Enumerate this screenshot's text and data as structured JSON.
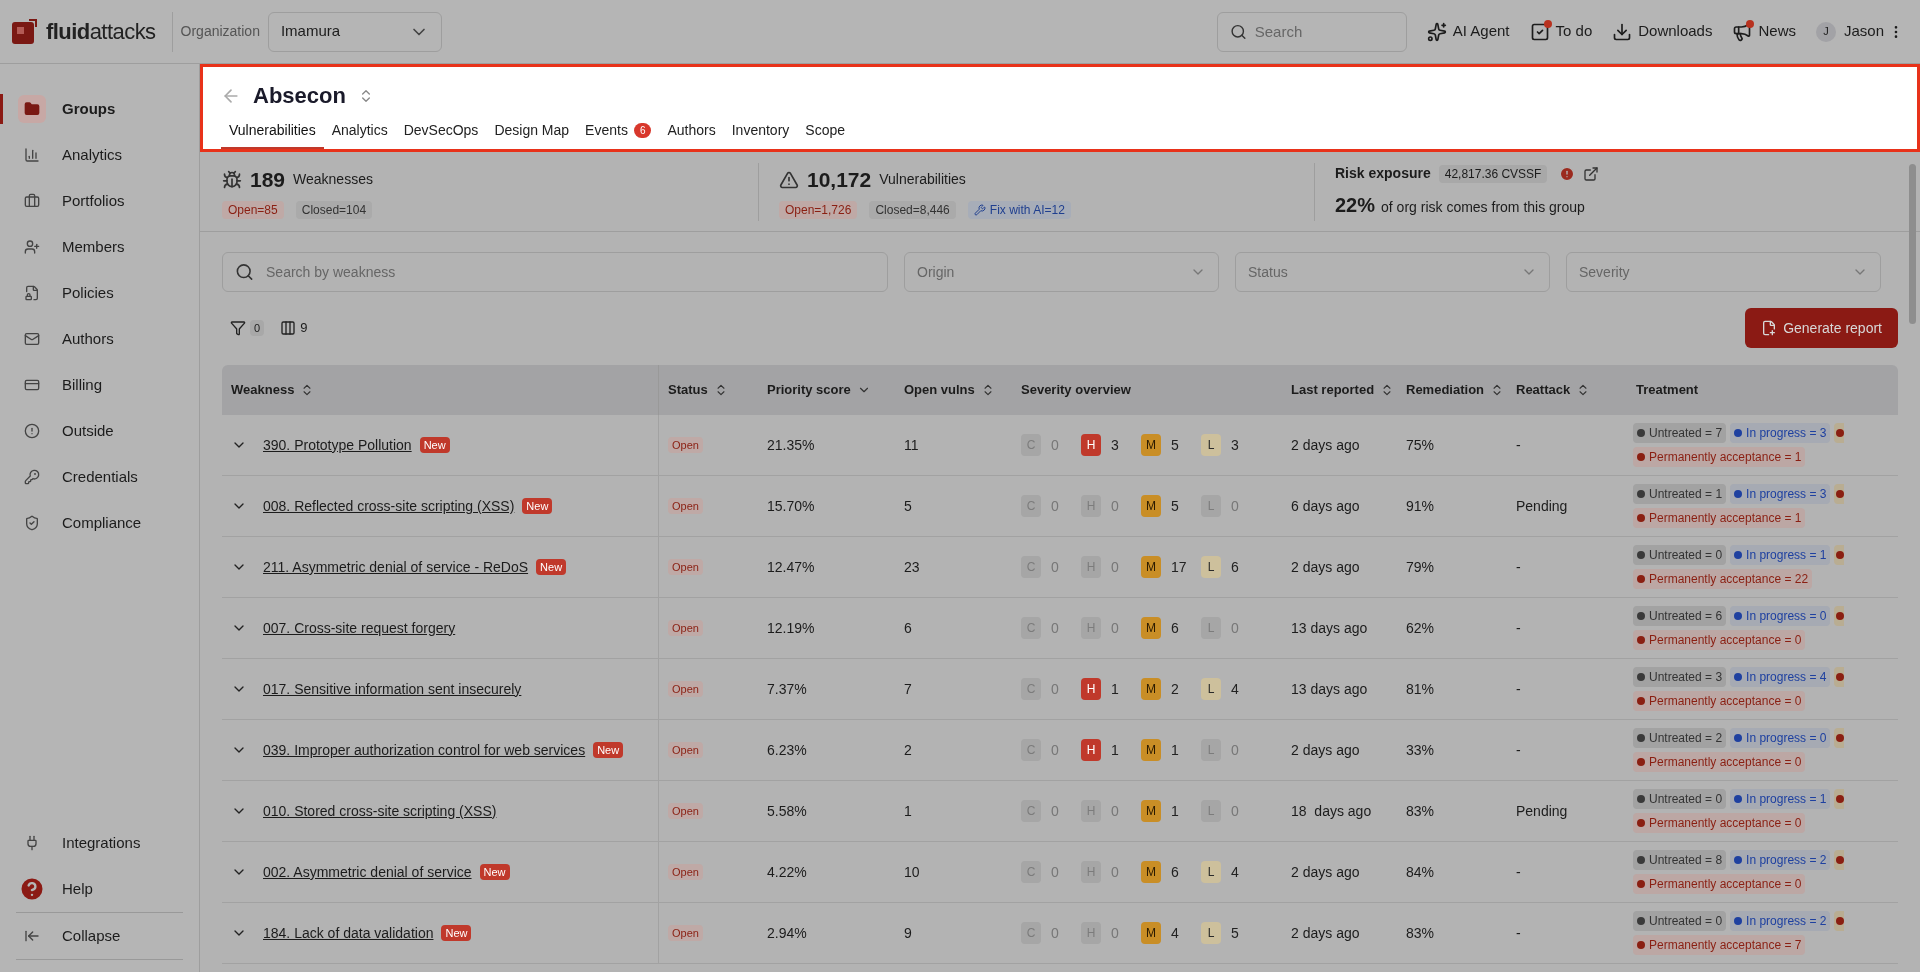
{
  "topbar": {
    "logo": {
      "bold": "fluid",
      "light": "attacks"
    },
    "org_label": "Organization",
    "org_select": "Imamura",
    "search": {
      "placeholder": "Search"
    },
    "actions": [
      {
        "kind": "ai",
        "label": "AI Agent",
        "dot": false
      },
      {
        "kind": "todo",
        "label": "To do",
        "dot": true
      },
      {
        "kind": "download",
        "label": "Downloads",
        "dot": false
      },
      {
        "kind": "news",
        "label": "News",
        "dot": true
      }
    ],
    "user": {
      "initial": "J",
      "name": "Jason"
    }
  },
  "sidebar": {
    "items": [
      {
        "kind": "folder",
        "label": "Groups",
        "selected": true
      },
      {
        "kind": "chart",
        "label": "Analytics",
        "selected": false
      },
      {
        "kind": "briefcase",
        "label": "Portfolios",
        "selected": false
      },
      {
        "kind": "members",
        "label": "Members",
        "selected": false
      },
      {
        "kind": "policy",
        "label": "Policies",
        "selected": false
      },
      {
        "kind": "mail",
        "label": "Authors",
        "selected": false
      },
      {
        "kind": "card",
        "label": "Billing",
        "selected": false
      },
      {
        "kind": "outside",
        "label": "Outside",
        "selected": false
      },
      {
        "kind": "key",
        "label": "Credentials",
        "selected": false
      },
      {
        "kind": "shield",
        "label": "Compliance",
        "selected": false
      }
    ],
    "bottom_items": [
      {
        "kind": "plug",
        "label": "Integrations"
      },
      {
        "kind": "help",
        "label": "Help"
      },
      {
        "kind": "collapse",
        "label": "Collapse"
      }
    ]
  },
  "header": {
    "title": "Absecon",
    "tabs": [
      {
        "label": "Vulnerabilities",
        "selected": true
      },
      {
        "label": "Analytics",
        "selected": false
      },
      {
        "label": "DevSecOps",
        "selected": false
      },
      {
        "label": "Design Map",
        "selected": false
      },
      {
        "label": "Events",
        "selected": false,
        "badge": "6"
      },
      {
        "label": "Authors",
        "selected": false
      },
      {
        "label": "Inventory",
        "selected": false
      },
      {
        "label": "Scope",
        "selected": false
      }
    ]
  },
  "stats": {
    "weaknesses": {
      "count": "189",
      "label": "Weaknesses",
      "open": "Open=85",
      "closed": "Closed=104"
    },
    "vulnerabilities": {
      "count": "10,172",
      "label": "Vulnerabilities",
      "open": "Open=1,726",
      "closed": "Closed=8,446",
      "fix": "Fix with AI=12"
    },
    "risk": {
      "label": "Risk exposure",
      "value": "42,817.36 CVSSF",
      "percent": "22%",
      "text": "of org risk comes from this group"
    }
  },
  "filters": {
    "search": {
      "placeholder": "Search by weakness"
    },
    "selects": [
      "Origin",
      "Status",
      "Severity"
    ],
    "filter_count": "0",
    "column_count": "9",
    "report_button": "Generate report"
  },
  "table": {
    "columns": [
      {
        "label": "Weakness",
        "sortable": true,
        "sorted": false
      },
      {
        "label": "Status",
        "sortable": true,
        "sorted": false
      },
      {
        "label": "Priority score",
        "sortable": true,
        "sorted": true
      },
      {
        "label": "Open vulns",
        "sortable": true,
        "sorted": false
      },
      {
        "label": "Severity overview",
        "sortable": false
      },
      {
        "label": "Last reported",
        "sortable": true,
        "sorted": false
      },
      {
        "label": "Remediation",
        "sortable": true,
        "sorted": false
      },
      {
        "label": "Reattack",
        "sortable": true,
        "sorted": false
      },
      {
        "label": "Treatment",
        "sortable": false
      }
    ],
    "rows": [
      {
        "weakness": {
          "name": "390. Prototype Pollution",
          "badge": "New"
        },
        "status": "Open",
        "priority": "21.35%",
        "open_vulns": "11",
        "severity": [
          {
            "label": "C",
            "count": "0",
            "active": false
          },
          {
            "label": "H",
            "count": "3",
            "active": true
          },
          {
            "label": "M",
            "count": "5",
            "active": true
          },
          {
            "label": "L",
            "count": "3",
            "active": true
          }
        ],
        "last_reported": "2 days ago",
        "remediation": "75%",
        "reattack": "-",
        "treatment": {
          "untreated": "Untreated = 7",
          "in_progress": "In progress = 3",
          "accepted": "Permanently acceptance = 1"
        }
      },
      {
        "weakness": {
          "name": "008. Reflected cross-site scripting (XSS)",
          "badge": "New"
        },
        "status": "Open",
        "priority": "15.70%",
        "open_vulns": "5",
        "severity": [
          {
            "label": "C",
            "count": "0",
            "active": false
          },
          {
            "label": "H",
            "count": "0",
            "active": false
          },
          {
            "label": "M",
            "count": "5",
            "active": true
          },
          {
            "label": "L",
            "count": "0",
            "active": false
          }
        ],
        "last_reported": "6 days ago",
        "remediation": "91%",
        "reattack": "Pending",
        "treatment": {
          "untreated": "Untreated = 1",
          "in_progress": "In progress = 3",
          "accepted": "Permanently acceptance = 1"
        }
      },
      {
        "weakness": {
          "name": "211. Asymmetric denial of service - ReDoS",
          "badge": "New"
        },
        "status": "Open",
        "priority": "12.47%",
        "open_vulns": "23",
        "severity": [
          {
            "label": "C",
            "count": "0",
            "active": false
          },
          {
            "label": "H",
            "count": "0",
            "active": false
          },
          {
            "label": "M",
            "count": "17",
            "active": true
          },
          {
            "label": "L",
            "count": "6",
            "active": true
          }
        ],
        "last_reported": "2 days ago",
        "remediation": "79%",
        "reattack": "-",
        "treatment": {
          "untreated": "Untreated = 0",
          "in_progress": "In progress = 1",
          "accepted": "Permanently acceptance = 22"
        }
      },
      {
        "weakness": {
          "name": "007. Cross-site request forgery"
        },
        "status": "Open",
        "priority": "12.19%",
        "open_vulns": "6",
        "severity": [
          {
            "label": "C",
            "count": "0",
            "active": false
          },
          {
            "label": "H",
            "count": "0",
            "active": false
          },
          {
            "label": "M",
            "count": "6",
            "active": true
          },
          {
            "label": "L",
            "count": "0",
            "active": false
          }
        ],
        "last_reported": "13 days ago",
        "remediation": "62%",
        "reattack": "-",
        "treatment": {
          "untreated": "Untreated = 6",
          "in_progress": "In progress = 0",
          "accepted": "Permanently acceptance = 0"
        }
      },
      {
        "weakness": {
          "name": "017. Sensitive information sent insecurely"
        },
        "status": "Open",
        "priority": "7.37%",
        "open_vulns": "7",
        "severity": [
          {
            "label": "C",
            "count": "0",
            "active": false
          },
          {
            "label": "H",
            "count": "1",
            "active": true
          },
          {
            "label": "M",
            "count": "2",
            "active": true
          },
          {
            "label": "L",
            "count": "4",
            "active": true
          }
        ],
        "last_reported": "13 days ago",
        "remediation": "81%",
        "reattack": "-",
        "treatment": {
          "untreated": "Untreated = 3",
          "in_progress": "In progress = 4",
          "accepted": "Permanently acceptance = 0"
        }
      },
      {
        "weakness": {
          "name": "039. Improper authorization control for web services",
          "badge": "New"
        },
        "status": "Open",
        "priority": "6.23%",
        "open_vulns": "2",
        "severity": [
          {
            "label": "C",
            "count": "0",
            "active": false
          },
          {
            "label": "H",
            "count": "1",
            "active": true
          },
          {
            "label": "M",
            "count": "1",
            "active": true
          },
          {
            "label": "L",
            "count": "0",
            "active": false
          }
        ],
        "last_reported": "2 days ago",
        "remediation": "33%",
        "reattack": "-",
        "treatment": {
          "untreated": "Untreated = 2",
          "in_progress": "In progress = 0",
          "accepted": "Permanently acceptance = 0"
        }
      },
      {
        "weakness": {
          "name": "010. Stored cross-site scripting (XSS)"
        },
        "status": "Open",
        "priority": "5.58%",
        "open_vulns": "1",
        "severity": [
          {
            "label": "C",
            "count": "0",
            "active": false
          },
          {
            "label": "H",
            "count": "0",
            "active": false
          },
          {
            "label": "M",
            "count": "1",
            "active": true
          },
          {
            "label": "L",
            "count": "0",
            "active": false
          }
        ],
        "last_reported": "18  days ago",
        "remediation": "83%",
        "reattack": "Pending",
        "treatment": {
          "untreated": "Untreated = 0",
          "in_progress": "In progress = 1",
          "accepted": "Permanently acceptance = 0"
        }
      },
      {
        "weakness": {
          "name": "002. Asymmetric denial of service",
          "badge": "New"
        },
        "status": "Open",
        "priority": "4.22%",
        "open_vulns": "10",
        "severity": [
          {
            "label": "C",
            "count": "0",
            "active": false
          },
          {
            "label": "H",
            "count": "0",
            "active": false
          },
          {
            "label": "M",
            "count": "6",
            "active": true
          },
          {
            "label": "L",
            "count": "4",
            "active": true
          }
        ],
        "last_reported": "2 days ago",
        "remediation": "84%",
        "reattack": "-",
        "treatment": {
          "untreated": "Untreated = 8",
          "in_progress": "In progress = 2",
          "accepted": "Permanently acceptance = 0"
        }
      },
      {
        "weakness": {
          "name": "184. Lack of data validation",
          "badge": "New"
        },
        "status": "Open",
        "priority": "2.94%",
        "open_vulns": "9",
        "severity": [
          {
            "label": "C",
            "count": "0",
            "active": false
          },
          {
            "label": "H",
            "count": "0",
            "active": false
          },
          {
            "label": "M",
            "count": "4",
            "active": true
          },
          {
            "label": "L",
            "count": "5",
            "active": true
          }
        ],
        "last_reported": "2 days ago",
        "remediation": "83%",
        "reattack": "-",
        "treatment": {
          "untreated": "Untreated = 0",
          "in_progress": "In progress = 2",
          "accepted": "Permanently acceptance = 7"
        }
      }
    ]
  }
}
